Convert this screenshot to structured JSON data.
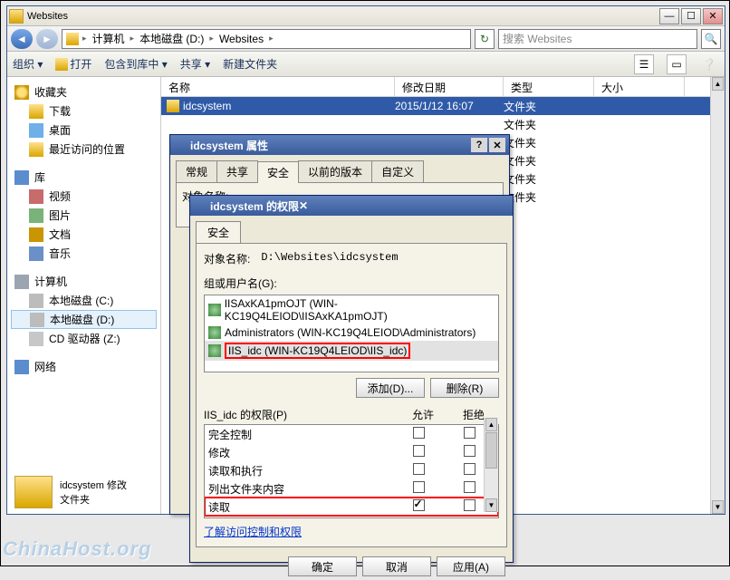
{
  "explorer": {
    "title": "Websites",
    "address": {
      "parts": [
        "计算机",
        "本地磁盘 (D:)",
        "Websites"
      ]
    },
    "search_placeholder": "搜索 Websites",
    "toolbar": {
      "organize": "组织 ▾",
      "open": "打开",
      "include": "包含到库中 ▾",
      "share": "共享 ▾",
      "newfolder": "新建文件夹"
    },
    "columns": {
      "name": "名称",
      "modified": "修改日期",
      "type": "类型",
      "size": "大小"
    },
    "nav": {
      "fav": "收藏夹",
      "dl": "下载",
      "desktop": "桌面",
      "recent": "最近访问的位置",
      "lib": "库",
      "vid": "视频",
      "pic": "图片",
      "doc": "文档",
      "mus": "音乐",
      "comp": "计算机",
      "diskc": "本地磁盘 (C:)",
      "diskd": "本地磁盘 (D:)",
      "cdz": "CD 驱动器 (Z:)",
      "net": "网络"
    },
    "rows": [
      {
        "name": "idcsystem",
        "date": "2015/1/12 16:07",
        "type": "文件夹"
      },
      {
        "name": "",
        "date": "",
        "type": "文件夹"
      },
      {
        "name": "",
        "date": "",
        "type": "文件夹"
      },
      {
        "name": "",
        "date": "",
        "type": "文件夹"
      },
      {
        "name": "",
        "date": "",
        "type": "文件夹"
      },
      {
        "name": "",
        "date": "",
        "type": "文件夹"
      }
    ],
    "status": {
      "line1": "idcsystem 修改",
      "line2": "文件夹"
    }
  },
  "prop": {
    "title": "idcsystem 属性",
    "tabs": {
      "general": "常规",
      "share": "共享",
      "security": "安全",
      "prev": "以前的版本",
      "custom": "自定义"
    },
    "objname_label": "对象名称:"
  },
  "perm": {
    "title": "idcsystem 的权限",
    "tab": "安全",
    "objname_label": "对象名称:",
    "objname_value": "D:\\Websites\\idcsystem",
    "group_label": "组或用户名(G):",
    "users": [
      "IISAxKA1pmOJT (WIN-KC19Q4LEIOD\\IISAxKA1pmOJT)",
      "Administrators (WIN-KC19Q4LEIOD\\Administrators)",
      "IIS_idc (WIN-KC19Q4LEIOD\\IIS_idc)"
    ],
    "add_btn": "添加(D)...",
    "remove_btn": "删除(R)",
    "perm_header": "IIS_idc 的权限(P)",
    "allow": "允许",
    "deny": "拒绝",
    "perms": [
      {
        "label": "完全控制",
        "allow": false,
        "deny": false
      },
      {
        "label": "修改",
        "allow": false,
        "deny": false
      },
      {
        "label": "读取和执行",
        "allow": false,
        "deny": false
      },
      {
        "label": "列出文件夹内容",
        "allow": false,
        "deny": false
      },
      {
        "label": "读取",
        "allow": true,
        "deny": false
      }
    ],
    "link": "了解访问控制和权限",
    "ok": "确定",
    "cancel": "取消",
    "apply": "应用(A)"
  },
  "watermark": "ChinaHost.org"
}
